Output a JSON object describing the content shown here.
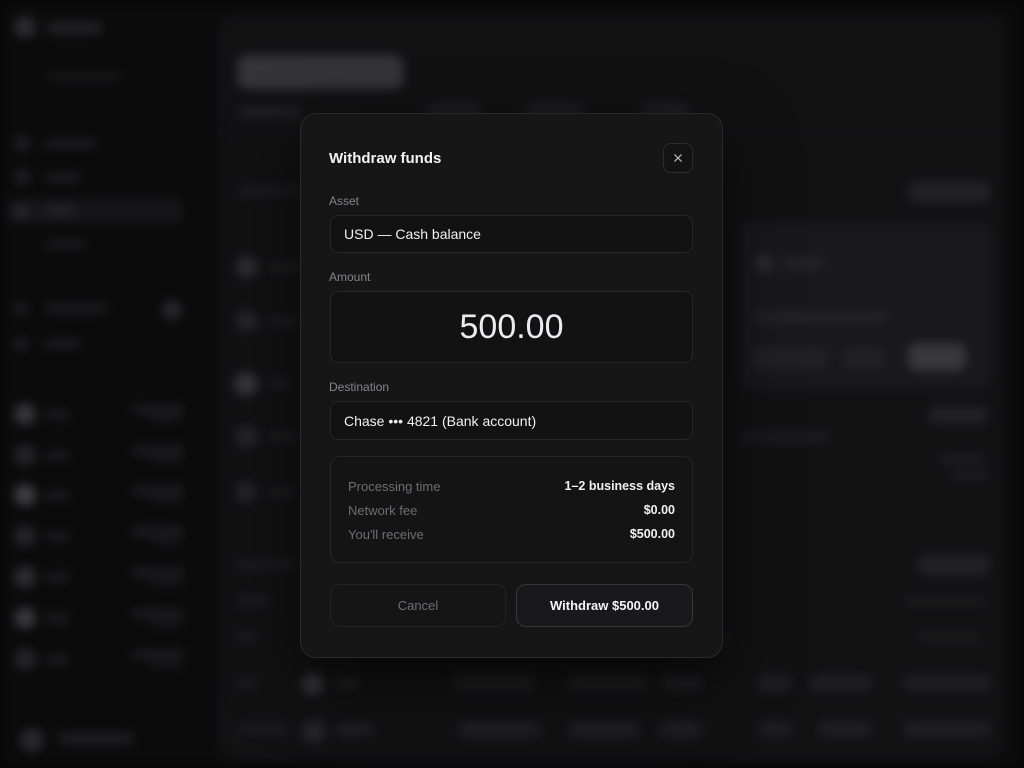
{
  "modal": {
    "title": "Withdraw funds",
    "close_icon": "close-icon",
    "asset": {
      "label": "Asset",
      "value": "USD — Cash balance"
    },
    "amount": {
      "label": "Amount",
      "value": "500.00"
    },
    "destination": {
      "label": "Destination",
      "value": "Chase ••• 4821 (Bank account)"
    },
    "summary": [
      {
        "label": "Processing time",
        "value": "1–2 business days"
      },
      {
        "label": "Network fee",
        "value": "$0.00"
      },
      {
        "label": "You'll receive",
        "value": "$500.00"
      }
    ],
    "cancel_label": "Cancel",
    "submit_label": "Withdraw $500.00"
  },
  "colors": {
    "page_background": "#0b0b0c",
    "dialog_background": "#161617",
    "border": "#262628",
    "text_primary": "#f2f2f3",
    "text_muted": "#85858a"
  }
}
